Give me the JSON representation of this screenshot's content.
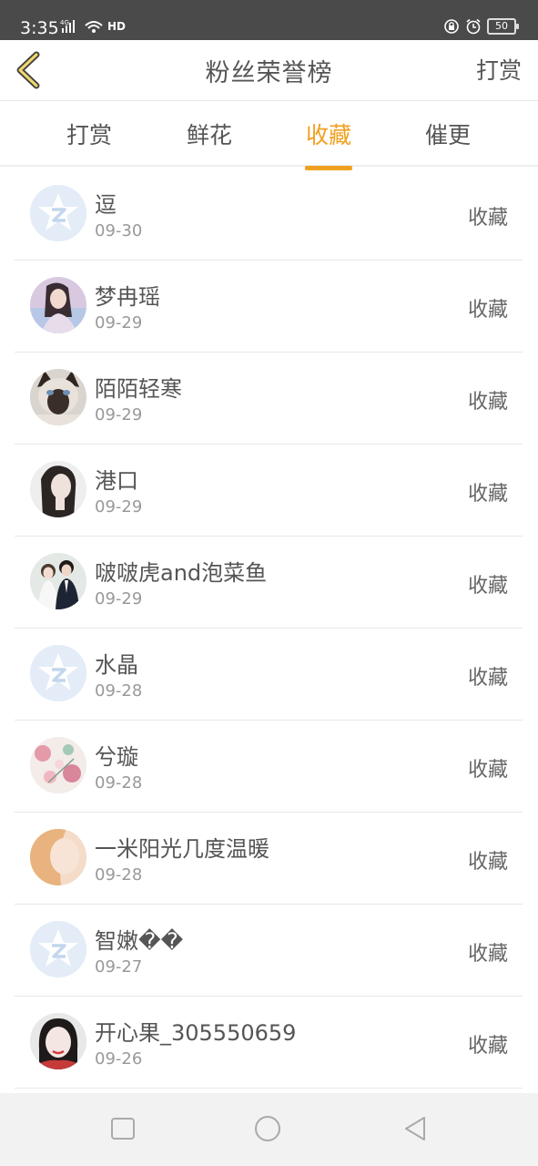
{
  "status_bar": {
    "time": "3:35",
    "network": "4G",
    "hd": "HD",
    "battery": "50"
  },
  "header": {
    "title": "粉丝荣誉榜",
    "action": "打赏",
    "accent_color": "#f0a020"
  },
  "tabs": [
    {
      "label": "打赏",
      "active": false
    },
    {
      "label": "鲜花",
      "active": false
    },
    {
      "label": "收藏",
      "active": true
    },
    {
      "label": "催更",
      "active": false
    }
  ],
  "fans": [
    {
      "name": "逗",
      "date": "09-30",
      "action": "收藏",
      "avatar": "default-qq-avatar"
    },
    {
      "name": "梦冉瑶",
      "date": "09-29",
      "action": "收藏",
      "avatar": "girl-photo-avatar"
    },
    {
      "name": "陌陌轻寒",
      "date": "09-29",
      "action": "收藏",
      "avatar": "siamese-cat-avatar"
    },
    {
      "name": "港口",
      "date": "09-29",
      "action": "收藏",
      "avatar": "woman-portrait-avatar"
    },
    {
      "name": "啵啵虎and泡菜鱼",
      "date": "09-29",
      "action": "收藏",
      "avatar": "couple-photo-avatar"
    },
    {
      "name": "水晶",
      "date": "09-28",
      "action": "收藏",
      "avatar": "default-qq-avatar"
    },
    {
      "name": "兮璇",
      "date": "09-28",
      "action": "收藏",
      "avatar": "flower-art-avatar"
    },
    {
      "name": "一米阳光几度温暖",
      "date": "09-28",
      "action": "收藏",
      "avatar": "blonde-girl-avatar"
    },
    {
      "name": "智嫩��",
      "date": "09-27",
      "action": "收藏",
      "avatar": "default-qq-avatar"
    },
    {
      "name": "开心果_305550659",
      "date": "09-26",
      "action": "收藏",
      "avatar": "girl-face-avatar"
    }
  ]
}
